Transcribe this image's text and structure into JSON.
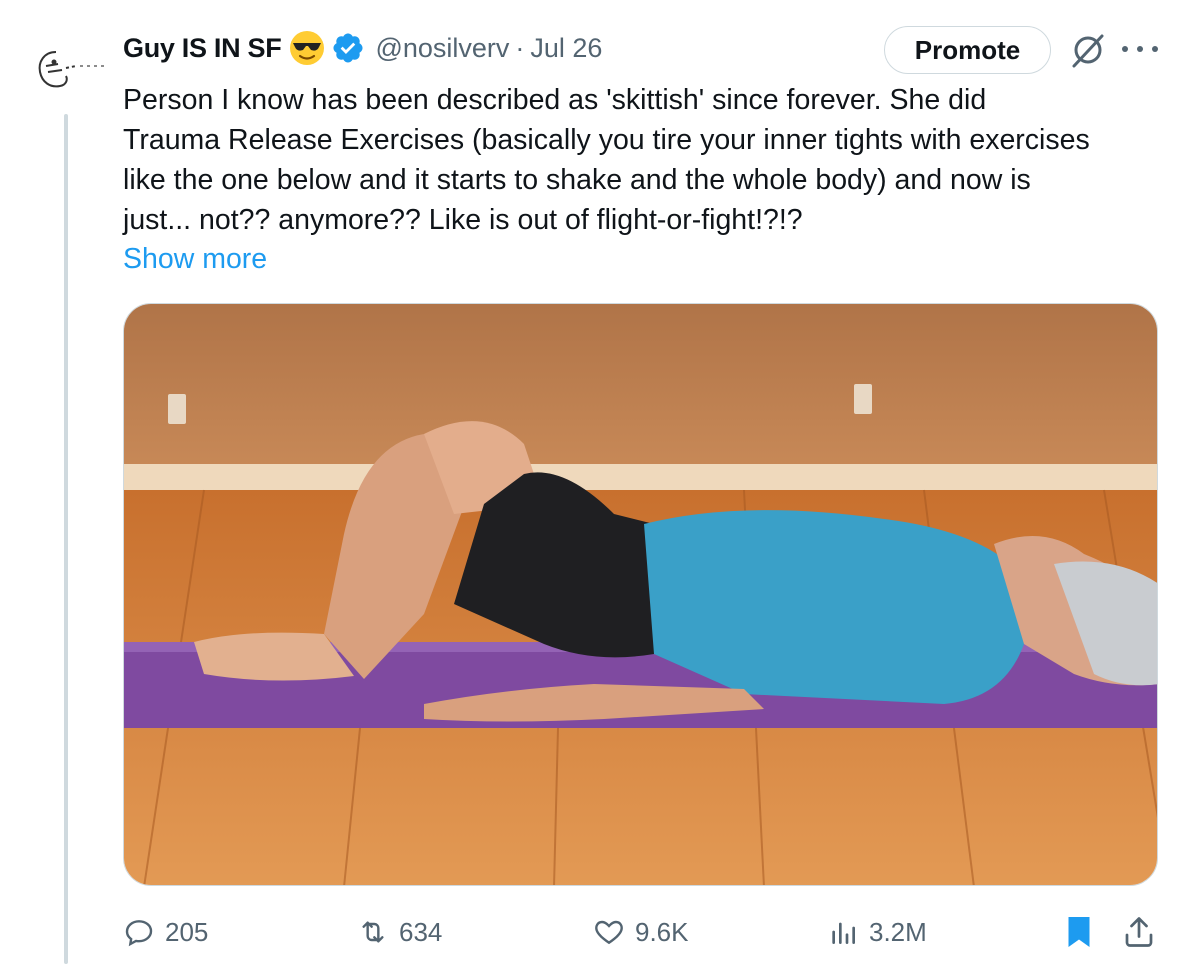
{
  "tweet": {
    "display_name": "Guy IS IN SF",
    "handle": "@nosilverv",
    "separator": "·",
    "date": "Jul 26",
    "text_lines": [
      "Person I know has been described as 'skittish' since forever. She did",
      "Trauma Release Exercises (basically you tire your inner tights with exercises",
      "like the one below and it starts to shake and the whole body) and now is",
      "just... not?? anymore?? Like is out of flight-or-fight!?!?"
    ],
    "show_more": "Show more",
    "promote_label": "Promote"
  },
  "icons": {
    "emoji": "sunglasses-emoji",
    "verified": "verified-badge-icon",
    "grok": "grok-icon",
    "more": "more-icon",
    "reply": "reply-icon",
    "retweet": "retweet-icon",
    "like": "heart-icon",
    "views": "views-icon",
    "bookmark": "bookmark-icon",
    "share": "share-icon"
  },
  "actions": {
    "replies": "205",
    "reposts": "634",
    "likes": "9.6K",
    "views": "3.2M"
  },
  "colors": {
    "accent": "#1d9bf0",
    "secondary_text": "#536471",
    "border": "#cfd9de"
  }
}
